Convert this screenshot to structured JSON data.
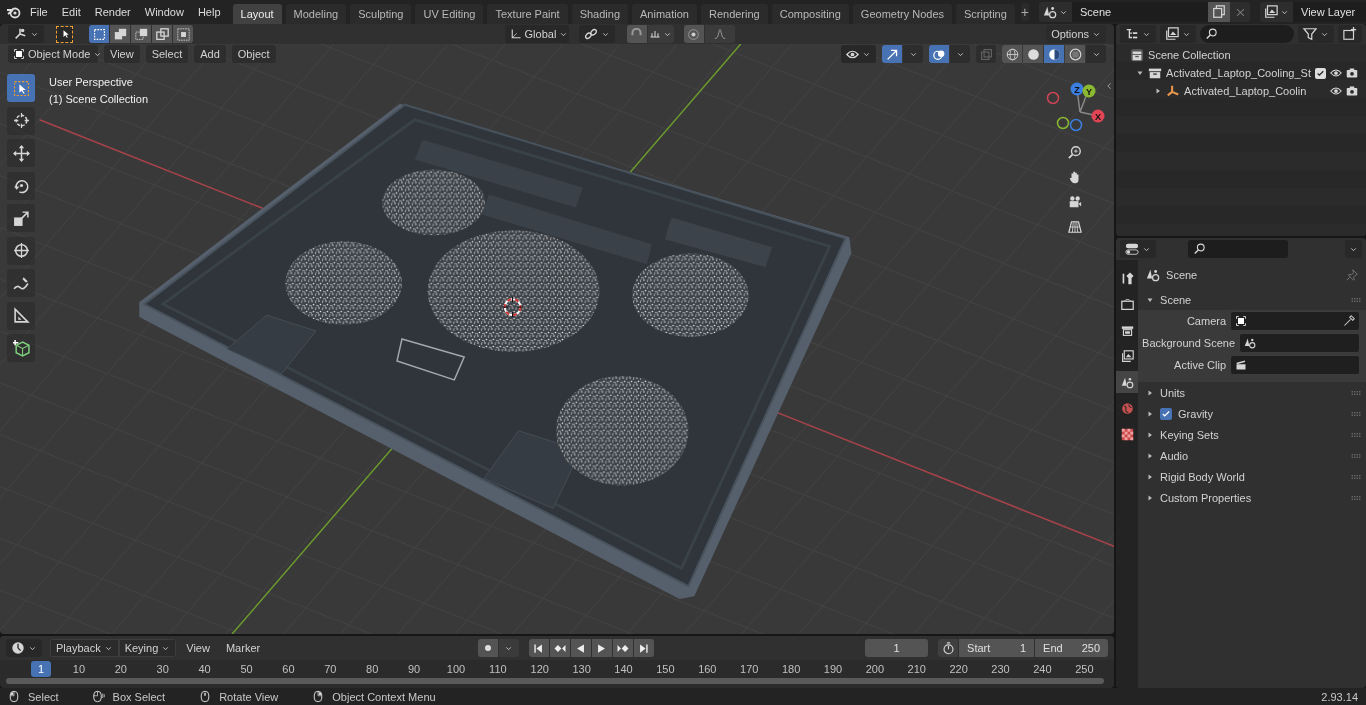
{
  "top_bar": {
    "menus": [
      "File",
      "Edit",
      "Render",
      "Window",
      "Help"
    ],
    "workspaces": [
      {
        "label": "Layout",
        "selected": true
      },
      {
        "label": "Modeling",
        "selected": false
      },
      {
        "label": "Sculpting",
        "selected": false
      },
      {
        "label": "UV Editing",
        "selected": false
      },
      {
        "label": "Texture Paint",
        "selected": false
      },
      {
        "label": "Shading",
        "selected": false
      },
      {
        "label": "Animation",
        "selected": false
      },
      {
        "label": "Rendering",
        "selected": false
      },
      {
        "label": "Compositing",
        "selected": false
      },
      {
        "label": "Geometry Nodes",
        "selected": false
      },
      {
        "label": "Scripting",
        "selected": false
      }
    ],
    "add_workspace": "+",
    "scene": "Scene",
    "view_layer": "View Layer"
  },
  "viewport": {
    "select_modes": [
      {
        "kind": "new",
        "selected": true
      },
      {
        "kind": "extend",
        "selected": false
      },
      {
        "kind": "subtract",
        "selected": false
      },
      {
        "kind": "difference",
        "selected": false
      },
      {
        "kind": "intersect",
        "selected": false
      }
    ],
    "transform_orientation": "Global",
    "options": "Options",
    "mode": "Object Mode",
    "menus": [
      "View",
      "Select",
      "Add",
      "Object"
    ],
    "shading": [
      {
        "kind": "wireframe",
        "selected": false
      },
      {
        "kind": "solid",
        "selected": false
      },
      {
        "kind": "material",
        "selected": true
      },
      {
        "kind": "rendered",
        "selected": false
      }
    ],
    "toolbar": [
      {
        "kind": "select",
        "selected": true
      },
      {
        "kind": "cursor",
        "selected": false
      },
      {
        "kind": "move",
        "selected": false
      },
      {
        "kind": "rotate",
        "selected": false
      },
      {
        "kind": "scale",
        "selected": false
      },
      {
        "kind": "transform",
        "selected": false
      },
      {
        "kind": "annotate",
        "selected": false
      },
      {
        "kind": "measure",
        "selected": false
      },
      {
        "kind": "add-cube",
        "selected": false
      }
    ],
    "info": [
      "User Perspective",
      "(1) Scene Collection"
    ],
    "gizmo_axes": [
      "X",
      "Y",
      "Z"
    ]
  },
  "outliner": {
    "items": [
      {
        "label": "Scene Collection",
        "kind": "scene",
        "children": [
          {
            "label": "Activated_Laptop_Cooling_St",
            "kind": "collection",
            "expanded": true,
            "checked": true,
            "children": [
              {
                "label": "Activated_Laptop_Coolin",
                "kind": "object",
                "expanded": false
              }
            ]
          }
        ]
      }
    ]
  },
  "properties": {
    "tabs": [
      {
        "kind": "tool",
        "selected": false
      },
      {
        "kind": "render",
        "selected": false
      },
      {
        "kind": "output",
        "selected": false
      },
      {
        "kind": "view-layer",
        "selected": false
      },
      {
        "kind": "scene",
        "selected": true
      },
      {
        "kind": "world",
        "selected": false
      },
      {
        "kind": "texture",
        "selected": false
      }
    ],
    "context": "Scene",
    "panel": {
      "title": "Scene",
      "expanded": true,
      "fields": [
        {
          "label": "Camera",
          "kind": "camera"
        },
        {
          "label": "Background Scene",
          "kind": "scene"
        },
        {
          "label": "Active Clip",
          "kind": "clip"
        }
      ]
    },
    "subpanels": [
      {
        "label": "Units",
        "expanded": false
      },
      {
        "label": "Gravity",
        "expanded": false,
        "checked": true
      },
      {
        "label": "Keying Sets",
        "expanded": false
      },
      {
        "label": "Audio",
        "expanded": false
      },
      {
        "label": "Rigid Body World",
        "expanded": false
      },
      {
        "label": "Custom Properties",
        "expanded": false
      }
    ]
  },
  "timeline": {
    "menus": [
      "Playback",
      "Keying",
      "View",
      "Marker"
    ],
    "current_frame": "1",
    "frame_marker": "1",
    "start_label": "Start",
    "start": "1",
    "end_label": "End",
    "end": "250",
    "ruler": [
      "10",
      "20",
      "30",
      "40",
      "50",
      "60",
      "70",
      "80",
      "90",
      "100",
      "110",
      "120",
      "130",
      "140",
      "150",
      "160",
      "170",
      "180",
      "190",
      "200",
      "210",
      "220",
      "230",
      "240",
      "250"
    ]
  },
  "status_bar": {
    "items": [
      {
        "label": "Select",
        "kind": "left"
      },
      {
        "label": "Box Select",
        "kind": "drag"
      },
      {
        "label": "Rotate View",
        "kind": "middle"
      },
      {
        "label": "Object Context Menu",
        "kind": "right"
      }
    ],
    "version": "2.93.14"
  }
}
